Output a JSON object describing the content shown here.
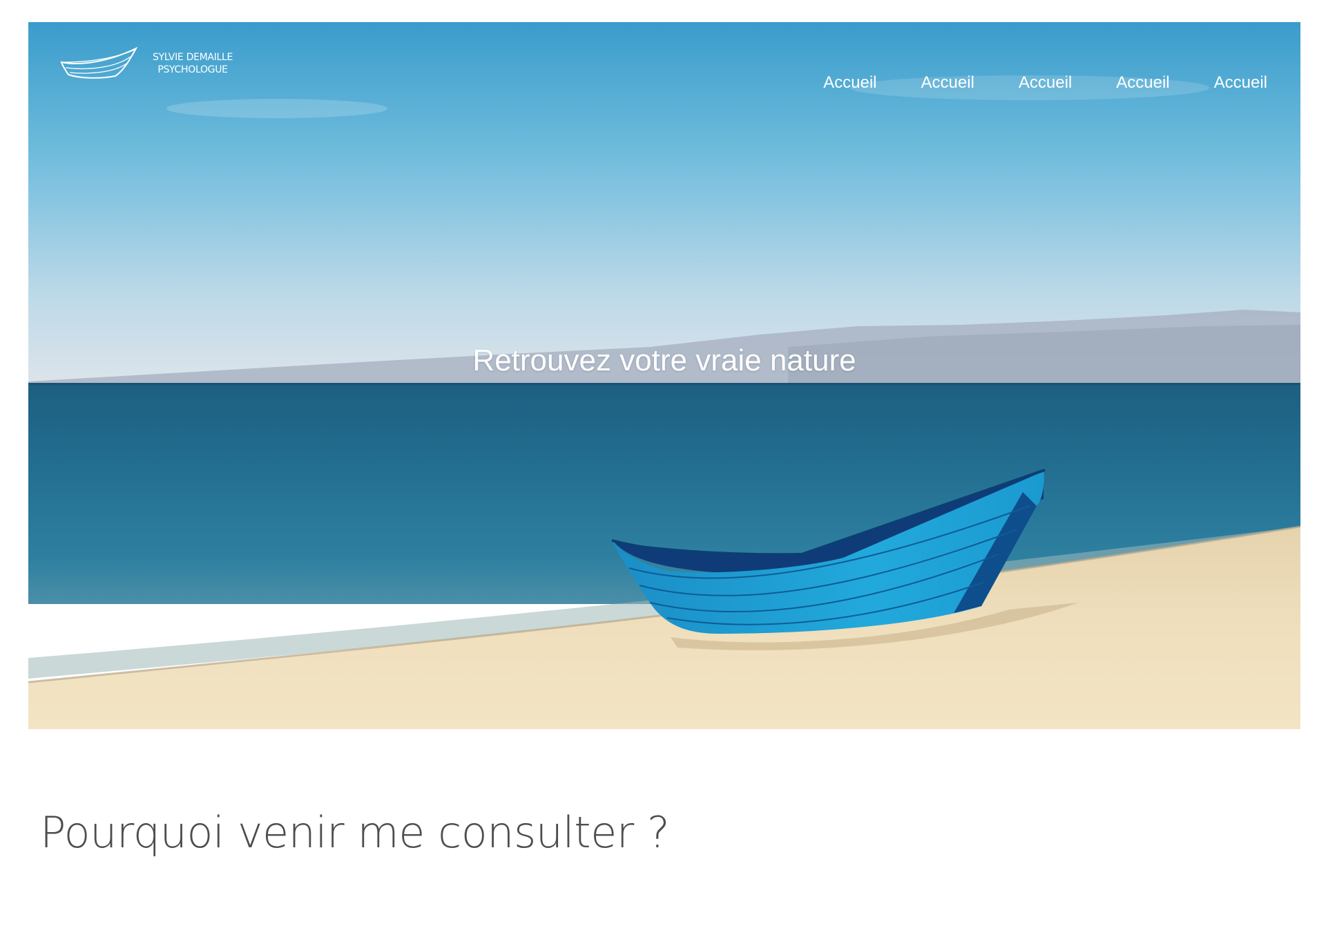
{
  "brand": {
    "name_line1": "SYLVIE DEMAILLE",
    "name_line2": "PSYCHOLOGUE",
    "logo_icon": "boat-icon"
  },
  "nav": {
    "items": [
      {
        "label": "Accueil"
      },
      {
        "label": "Accueil"
      },
      {
        "label": "Accueil"
      },
      {
        "label": "Accueil"
      },
      {
        "label": "Accueil"
      }
    ]
  },
  "hero": {
    "headline": "Retrouvez votre vraie nature",
    "image_subject": "blue-boat-on-beach"
  },
  "section": {
    "title": "Pourquoi venir me consulter ?"
  },
  "colors": {
    "sky_top": "#3fa2cd",
    "sky_horizon": "#d8e3ea",
    "sea": "#1f6f8f",
    "sand": "#f0dfbc",
    "boat": "#1d9ed3",
    "heading_text": "#4d4d4d"
  }
}
